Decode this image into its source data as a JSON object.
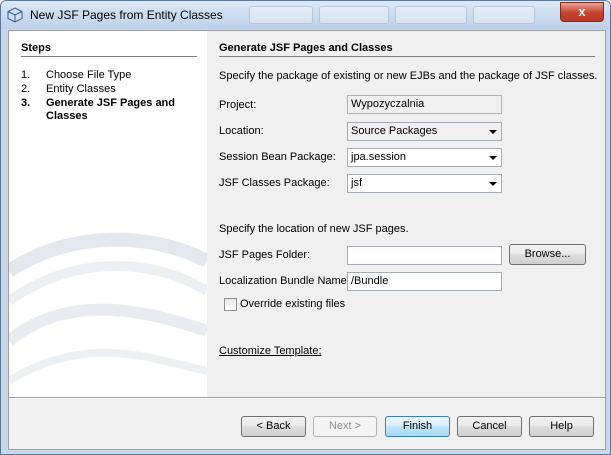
{
  "window": {
    "title": "New JSF Pages from Entity Classes",
    "close_label": "x"
  },
  "steps": {
    "title": "Steps",
    "items": [
      {
        "num": "1.",
        "label": "Choose File Type"
      },
      {
        "num": "2.",
        "label": "Entity Classes"
      },
      {
        "num": "3.",
        "label": "Generate JSF Pages and Classes"
      }
    ],
    "current_index": 2
  },
  "main": {
    "title": "Generate JSF Pages and Classes",
    "description": "Specify the package of existing or new EJBs and the package of JSF classes.",
    "project_label": "Project:",
    "project_value": "Wypozyczalnia",
    "location_label": "Location:",
    "location_value": "Source Packages",
    "session_bean_label": "Session Bean Package:",
    "session_bean_value": "jpa.session",
    "jsf_classes_label": "JSF Classes Package:",
    "jsf_classes_value": "jsf",
    "pages_location_text": "Specify the location of new JSF pages.",
    "jsf_pages_folder_label": "JSF Pages Folder:",
    "jsf_pages_folder_value": "",
    "browse_label": "Browse...",
    "localization_label": "Localization Bundle Name:",
    "localization_value": "/Bundle",
    "override_label": "Override existing files",
    "override_checked": false,
    "customize_template_label": "Customize Template;"
  },
  "buttons": {
    "back": "< Back",
    "next": "Next >",
    "finish": "Finish",
    "cancel": "Cancel",
    "help": "Help"
  },
  "colors": {
    "title_bar": "#bcd1ea",
    "default_button": "#bee6fd",
    "close_button": "#c7432c"
  }
}
